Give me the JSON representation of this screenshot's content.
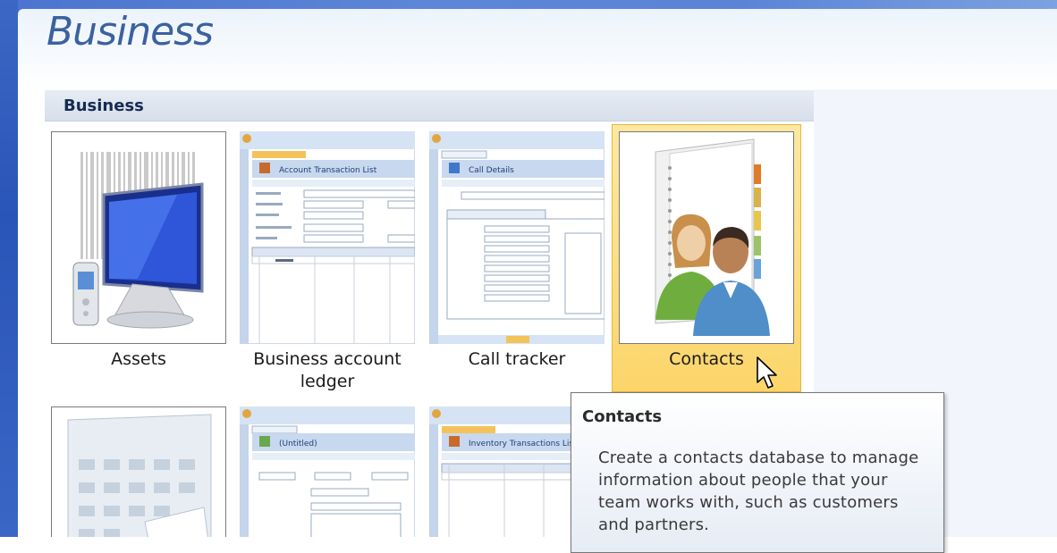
{
  "page": {
    "title": "Business"
  },
  "section": {
    "title": "Business"
  },
  "templates": [
    {
      "label": "Assets"
    },
    {
      "label": "Business account ledger"
    },
    {
      "label": "Call tracker"
    },
    {
      "label": "Contacts"
    }
  ],
  "thumbnails": {
    "ledger": {
      "title": "Account Transaction List"
    },
    "call": {
      "title": "Call Details"
    },
    "expense": {
      "title": "(Untitled)"
    },
    "inventory": {
      "title": "Inventory Transactions Lis"
    }
  },
  "tooltip": {
    "title": "Contacts",
    "text": "Create a contacts database to manage information about people that your team works with, such as customers and partners."
  },
  "colors": {
    "heading": "#3b629f",
    "selected_tile": "#fcd56a",
    "window_frame": "#2a55b8"
  }
}
